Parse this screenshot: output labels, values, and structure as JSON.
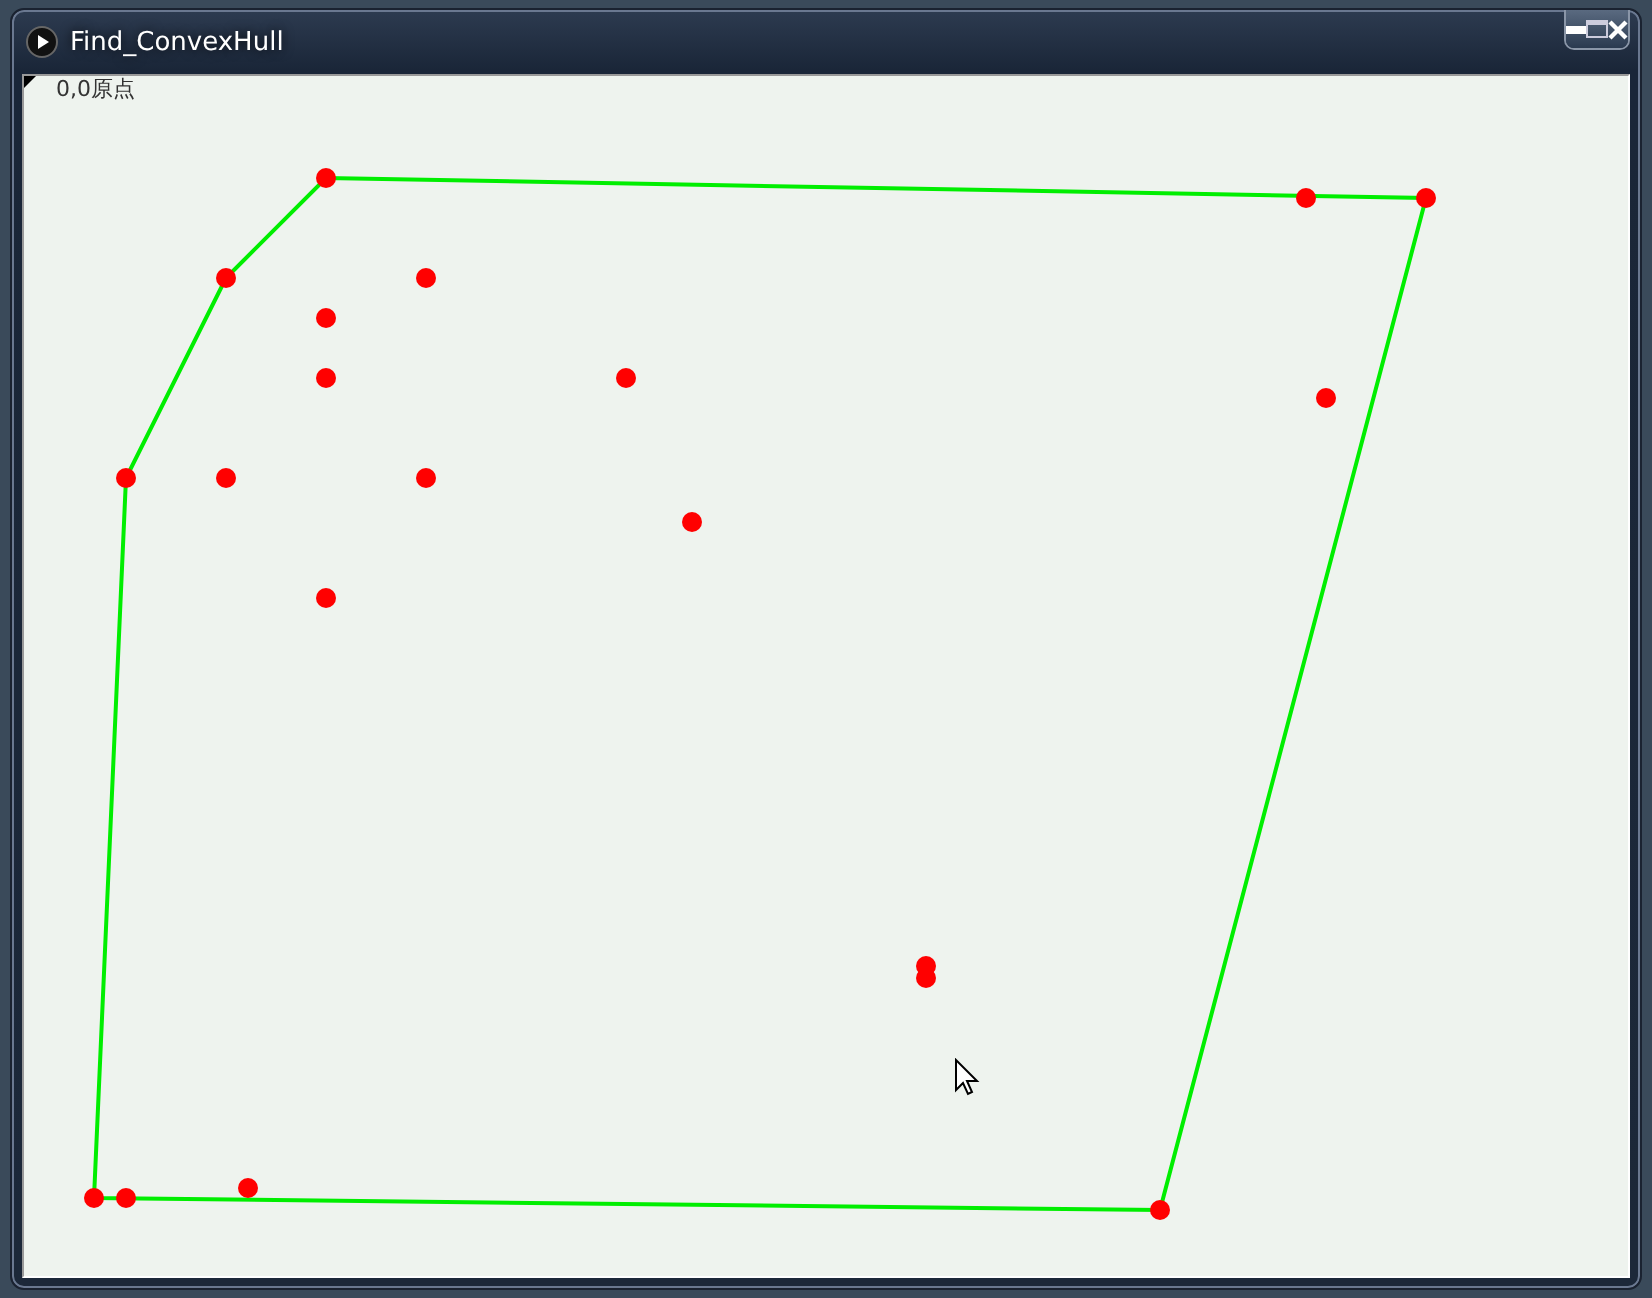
{
  "window": {
    "title": "Find_ConvexHull"
  },
  "canvas": {
    "origin_label": "0,0原点"
  }
}
